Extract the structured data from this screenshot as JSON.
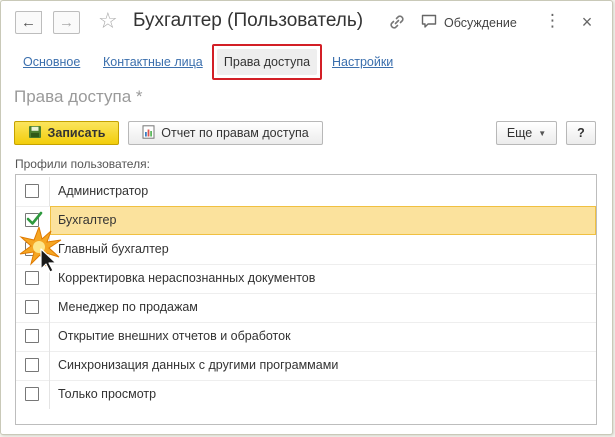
{
  "window": {
    "title": "Бухгалтер (Пользователь)",
    "discussion_label": "Обсуждение",
    "more_label": "⋮",
    "close_label": "×"
  },
  "tabs": [
    {
      "label": "Основное",
      "active": false
    },
    {
      "label": "Контактные лица",
      "active": false
    },
    {
      "label": "Права доступа",
      "active": true
    },
    {
      "label": "Настройки",
      "active": false
    }
  ],
  "section_title": "Права доступа *",
  "toolbar": {
    "save_label": "Записать",
    "report_label": "Отчет по правам доступа",
    "more_label": "Еще",
    "help_label": "?"
  },
  "profiles": {
    "label": "Профили пользователя:",
    "items": [
      {
        "label": "Администратор",
        "checked": false
      },
      {
        "label": "Бухгалтер",
        "checked": true,
        "selected": true
      },
      {
        "label": "Главный бухгалтер",
        "checked": false
      },
      {
        "label": "Корректировка нераспознанных документов",
        "checked": false
      },
      {
        "label": "Менеджер по продажам",
        "checked": false
      },
      {
        "label": "Открытие внешних отчетов и обработок",
        "checked": false
      },
      {
        "label": "Синхронизация данных с другими программами",
        "checked": false
      },
      {
        "label": "Только просмотр",
        "checked": false
      }
    ]
  },
  "colors": {
    "accent_yellow": "#f2cd0b",
    "selection_bg": "#fbe29d",
    "link_blue": "#3b6fad",
    "highlight_red": "#d31f26",
    "check_green": "#2e9a3e"
  },
  "icons": {
    "back": "arrow-left-icon",
    "forward": "arrow-right-icon",
    "favorite": "star-icon",
    "link": "link-icon",
    "discussion": "chat-icon",
    "save": "save-icon",
    "report": "report-icon",
    "dropdown": "chevron-down-icon",
    "pointer": "mouse-pointer-icon"
  }
}
